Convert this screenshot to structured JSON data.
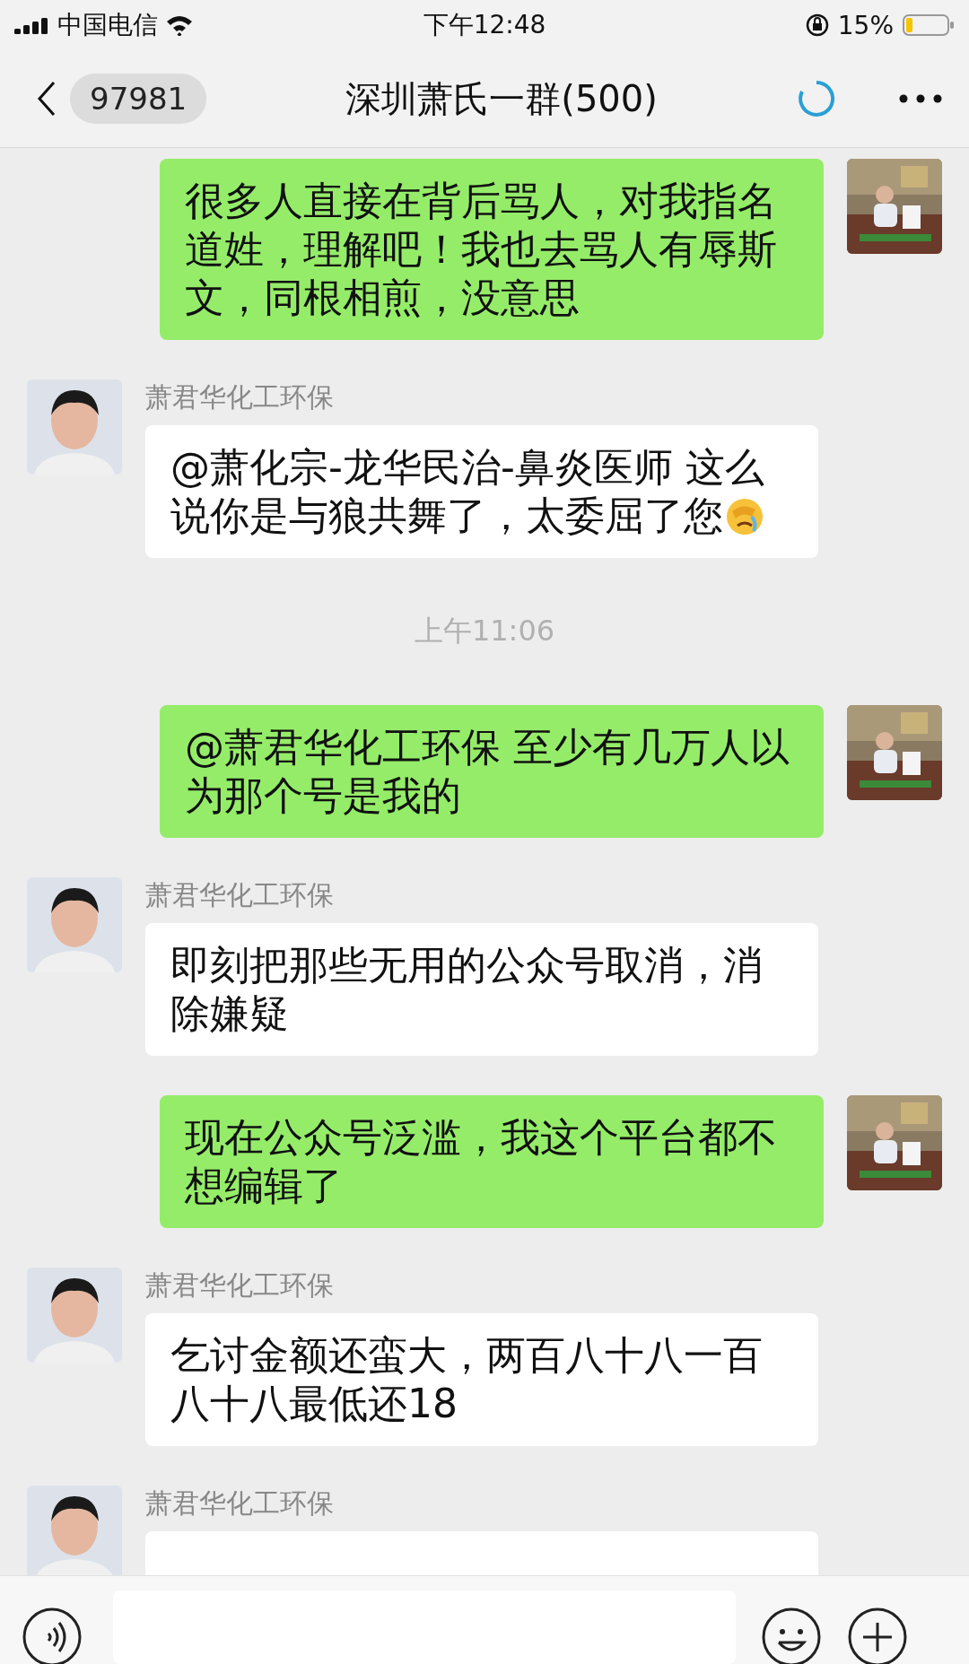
{
  "status_bar": {
    "carrier": "中国电信",
    "time": "下午12:48",
    "battery": "15%"
  },
  "header": {
    "back_count": "97981",
    "title": "深圳萧氏一群(500)"
  },
  "messages": [
    {
      "kind": "outgoing",
      "text": "很多人直接在背后骂人，对我指名道姓，理解吧！我也去骂人有辱斯文，同根相煎，没意思"
    },
    {
      "kind": "incoming",
      "sender": "萧君华化工环保",
      "text": "@萧化宗-龙华民治-鼻炎医师 这么说你是与狼共舞了，太委屈了您",
      "emoji": true
    },
    {
      "kind": "time",
      "text": "上午11:06"
    },
    {
      "kind": "outgoing",
      "text": "@萧君华化工环保 至少有几万人以为那个号是我的"
    },
    {
      "kind": "incoming",
      "sender": "萧君华化工环保",
      "text": "即刻把那些无用的公众号取消，消除嫌疑"
    },
    {
      "kind": "outgoing",
      "text": "现在公众号泛滥，我这个平台都不想编辑了"
    },
    {
      "kind": "incoming",
      "sender": "萧君华化工环保",
      "text": "乞讨金额还蛮大，两百八十八一百八十八最低还18"
    },
    {
      "kind": "incoming",
      "sender": "萧君华化工环保"
    }
  ]
}
